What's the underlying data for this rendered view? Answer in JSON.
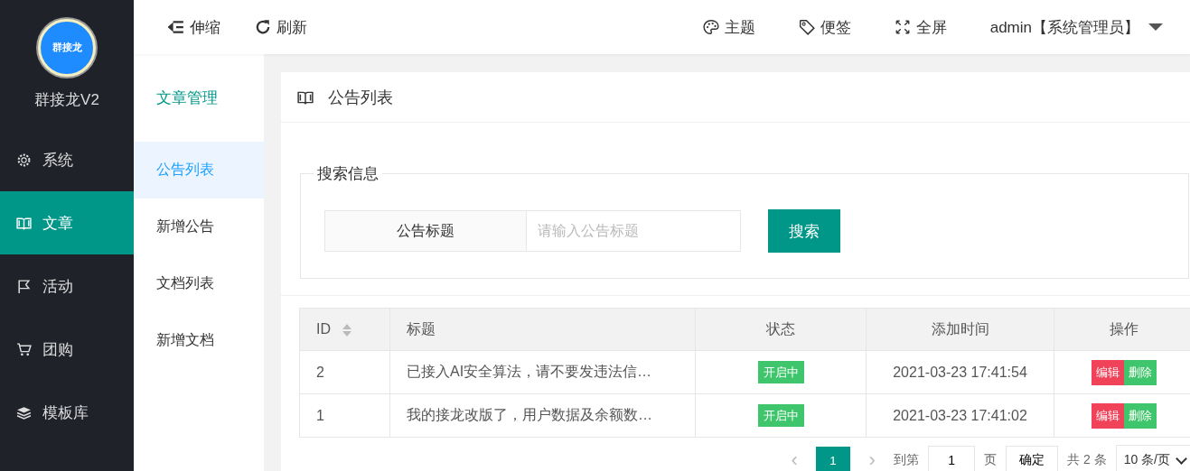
{
  "logo": {
    "badge": "群接龙",
    "name": "群接龙V2"
  },
  "nav": [
    {
      "label": "系统",
      "selected": false
    },
    {
      "label": "文章",
      "selected": true
    },
    {
      "label": "活动",
      "selected": false
    },
    {
      "label": "团购",
      "selected": false
    },
    {
      "label": "模板库",
      "selected": false
    }
  ],
  "toolbar": {
    "left": [
      {
        "label": "伸缩"
      },
      {
        "label": "刷新"
      }
    ],
    "right": [
      {
        "label": "主题"
      },
      {
        "label": "便签"
      },
      {
        "label": "全屏"
      }
    ],
    "user": "admin【系统管理员】"
  },
  "subnav": {
    "title": "文章管理",
    "items": [
      {
        "label": "公告列表",
        "selected": true
      },
      {
        "label": "新增公告",
        "selected": false
      },
      {
        "label": "文档列表",
        "selected": false
      },
      {
        "label": "新增文档",
        "selected": false
      }
    ]
  },
  "card": {
    "title": "公告列表"
  },
  "search": {
    "legend": "搜索信息",
    "label": "公告标题",
    "placeholder": "请输入公告标题",
    "button": "搜索"
  },
  "table": {
    "columns": [
      "ID",
      "标题",
      "状态",
      "添加时间",
      "操作"
    ],
    "rows": [
      {
        "id": "2",
        "title": "已接入AI安全算法，请不要发违法信…",
        "status": "开启中",
        "time": "2021-03-23 17:41:54",
        "actions": [
          "编辑",
          "删除"
        ]
      },
      {
        "id": "1",
        "title": "我的接龙改版了，用户数据及余额数…",
        "status": "开启中",
        "time": "2021-03-23 17:41:02",
        "actions": [
          "编辑",
          "删除"
        ]
      }
    ]
  },
  "pagination": {
    "prev": "‹",
    "pages": [
      {
        "label": "1",
        "selected": true
      }
    ],
    "next": "›",
    "goto": "到第",
    "page_value": "1",
    "page_unit": "页",
    "confirm": "确定",
    "total": "共 2 条",
    "page_size": "10 条/页"
  }
}
